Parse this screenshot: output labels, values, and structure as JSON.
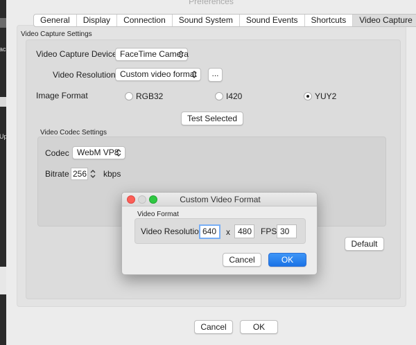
{
  "desktop": {
    "fragments": [
      "ac",
      "Up"
    ]
  },
  "window": {
    "title": "Preferences"
  },
  "tabs": [
    {
      "label": "General",
      "active": false
    },
    {
      "label": "Display",
      "active": false
    },
    {
      "label": "Connection",
      "active": false
    },
    {
      "label": "Sound System",
      "active": false
    },
    {
      "label": "Sound Events",
      "active": false
    },
    {
      "label": "Shortcuts",
      "active": false
    },
    {
      "label": "Video Capture",
      "active": true
    }
  ],
  "capture": {
    "section_title": "Video Capture Settings",
    "device_label": "Video Capture Device",
    "device_value": "FaceTime Camera",
    "resolution_label": "Video Resolution",
    "resolution_value": "Custom video format",
    "ellipsis_button": "...",
    "image_format_label": "Image Format",
    "formats": [
      {
        "label": "RGB32",
        "selected": false
      },
      {
        "label": "I420",
        "selected": false
      },
      {
        "label": "YUY2",
        "selected": true
      }
    ],
    "test_button": "Test Selected"
  },
  "codec": {
    "section_title": "Video Codec Settings",
    "codec_label": "Codec",
    "codec_value": "WebM VP8",
    "bitrate_label": "Bitrate",
    "bitrate_value": "256",
    "bitrate_unit": "kbps"
  },
  "default_button": "Default",
  "footer": {
    "cancel": "Cancel",
    "ok": "OK"
  },
  "dialog": {
    "title": "Custom Video Format",
    "section_title": "Video Format",
    "resolution_label": "Video Resolution",
    "width": "640",
    "times": "x",
    "height": "480",
    "fps_label": "FPS",
    "fps": "30",
    "cancel": "Cancel",
    "ok": "OK"
  },
  "colors": {
    "accent": "#1b73e6",
    "close_light": "#fc5f57",
    "min_light": "#dadada",
    "zoom_light": "#2fc842"
  }
}
